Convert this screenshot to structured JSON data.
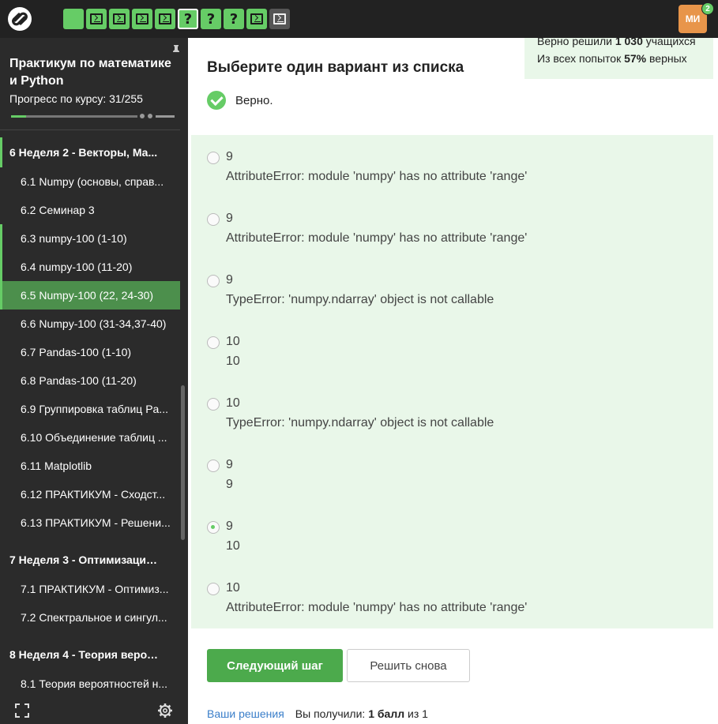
{
  "topbar": {
    "logo_icon": "stepik-logo-icon",
    "steps": [
      {
        "type": "text",
        "state": "done"
      },
      {
        "type": "code",
        "state": "done"
      },
      {
        "type": "code",
        "state": "done"
      },
      {
        "type": "code",
        "state": "done"
      },
      {
        "type": "code",
        "state": "done"
      },
      {
        "type": "quiz",
        "state": "current",
        "label": "?"
      },
      {
        "type": "quiz",
        "state": "done",
        "label": "?"
      },
      {
        "type": "quiz",
        "state": "done",
        "label": "?"
      },
      {
        "type": "code",
        "state": "done"
      },
      {
        "type": "code",
        "state": "todo"
      }
    ],
    "avatar_initials": "МИ",
    "avatar_badge": "2"
  },
  "sidebar": {
    "course_title": "Практикум по математике и Python",
    "progress_text": "Прогресс по курсу:  31/255",
    "progress_fraction": 0.12,
    "items": [
      {
        "label": "6  Неделя 2 - Векторы, Ма...",
        "kind": "section",
        "state": "done"
      },
      {
        "label": "6.1  Numpy (основы, справ...",
        "kind": "lesson",
        "state": "todo"
      },
      {
        "label": "6.2  Семинар 3",
        "kind": "lesson",
        "state": "todo"
      },
      {
        "label": "6.3  numpy-100 (1-10)",
        "kind": "lesson",
        "state": "done"
      },
      {
        "label": "6.4  numpy-100 (11-20)",
        "kind": "lesson",
        "state": "done"
      },
      {
        "label": "6.5  Numpy-100 (22, 24-30)",
        "kind": "lesson",
        "state": "active"
      },
      {
        "label": "6.6  Numpy-100 (31-34,37-40)",
        "kind": "lesson",
        "state": "todo"
      },
      {
        "label": "6.7  Pandas-100 (1-10)",
        "kind": "lesson",
        "state": "todo"
      },
      {
        "label": "6.8  Pandas-100 (11-20)",
        "kind": "lesson",
        "state": "todo"
      },
      {
        "label": "6.9  Группировка таблиц Pa...",
        "kind": "lesson",
        "state": "todo"
      },
      {
        "label": "6.10  Объединение таблиц ...",
        "kind": "lesson",
        "state": "todo"
      },
      {
        "label": "6.11  Matplotlib",
        "kind": "lesson",
        "state": "todo"
      },
      {
        "label": "6.12  ПРАКТИКУМ - Сходст...",
        "kind": "lesson",
        "state": "todo"
      },
      {
        "label": "6.13  ПРАКТИКУМ - Решени...",
        "kind": "lesson",
        "state": "todo"
      },
      {
        "label": "7  Неделя 3 - Оптимизация...",
        "kind": "section",
        "state": "todo"
      },
      {
        "label": "7.1  ПРАКТИКУМ - Оптимиз...",
        "kind": "lesson",
        "state": "todo"
      },
      {
        "label": "7.2  Спектральное и сингул...",
        "kind": "lesson",
        "state": "todo"
      },
      {
        "label": "8  Неделя 4 - Теория вероя...",
        "kind": "section",
        "state": "todo"
      },
      {
        "label": "8.1  Теория вероятностей н...",
        "kind": "lesson",
        "state": "todo"
      }
    ]
  },
  "stats": {
    "solved_prefix": "Верно решили ",
    "solved_count": "1 030",
    "solved_suffix": " учащихся",
    "attempts_prefix": "Из всех попыток ",
    "attempts_pct": "57%",
    "attempts_suffix": " верных"
  },
  "question": {
    "title": "Выберите один вариант из списка",
    "verdict": "Верно."
  },
  "options": [
    {
      "line1": "9",
      "line2": "AttributeError: module 'numpy' has no attribute 'range'",
      "checked": false
    },
    {
      "line1": "9",
      "line2": "AttributeError: module 'numpy' has no attribute 'range'",
      "checked": false
    },
    {
      "line1": "9",
      "line2": "TypeError: 'numpy.ndarray' object is not callable",
      "checked": false
    },
    {
      "line1": "10",
      "line2": "10",
      "checked": false
    },
    {
      "line1": "10",
      "line2": "TypeError: 'numpy.ndarray' object is not callable",
      "checked": false
    },
    {
      "line1": "9",
      "line2": "9",
      "checked": false
    },
    {
      "line1": "9",
      "line2": "10",
      "checked": true
    },
    {
      "line1": "10",
      "line2": "AttributeError: module 'numpy' has no attribute 'range'",
      "checked": false
    }
  ],
  "actions": {
    "next_label": "Следующий шаг",
    "retry_label": "Решить снова"
  },
  "footer": {
    "solutions_link": "Ваши решения",
    "score_prefix": "Вы получили: ",
    "score_value": "1 балл",
    "score_suffix": " из 1"
  },
  "colors": {
    "accent_green": "#66cc66",
    "button_green": "#4caa4c",
    "correct_bg": "#e9f7e9",
    "sidebar_bg": "#2b2b2b",
    "active_item": "#4c8f4c",
    "avatar": "#e8954a",
    "link": "#3a7ec9"
  }
}
